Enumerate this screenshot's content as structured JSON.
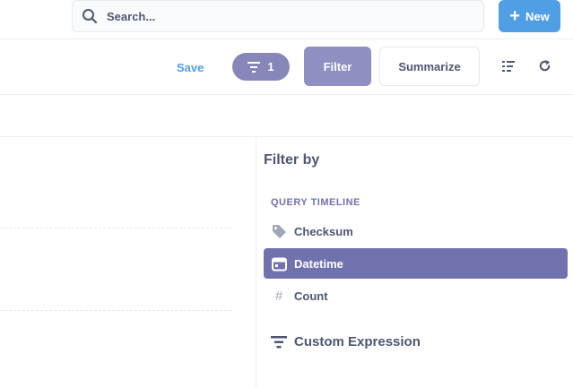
{
  "topbar": {
    "search_placeholder": "Search...",
    "new_label": "New"
  },
  "actionbar": {
    "save_label": "Save",
    "filter_count": "1",
    "filter_label": "Filter",
    "summarize_label": "Summarize"
  },
  "sidebar": {
    "title": "Filter by",
    "section_label": "QUERY TIMELINE",
    "fields": [
      {
        "label": "Checksum",
        "icon": "tag-icon",
        "active": false
      },
      {
        "label": "Datetime",
        "icon": "calendar-icon",
        "active": true
      },
      {
        "label": "Count",
        "icon": "hash-icon",
        "active": false
      }
    ],
    "custom_expression_label": "Custom Expression"
  },
  "colors": {
    "brand": "#509ee3",
    "accent": "#7172ad",
    "text": "#4c5773",
    "border": "#eceef2"
  }
}
